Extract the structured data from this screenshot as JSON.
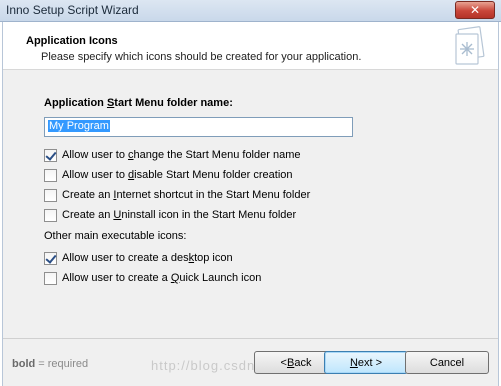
{
  "window": {
    "title": "Inno Setup Script Wizard",
    "close_glyph": "✕"
  },
  "header": {
    "title": "Application Icons",
    "subtitle": "Please specify which icons should be created for your application."
  },
  "start_menu": {
    "label_pre": "Application ",
    "label_u": "S",
    "label_post": "tart Menu folder name:",
    "value": "My Program"
  },
  "checkboxes": [
    {
      "pre": "Allow user to ",
      "u": "c",
      "post": "hange the Start Menu folder name",
      "checked": true
    },
    {
      "pre": "Allow user to ",
      "u": "d",
      "post": "isable Start Menu folder creation",
      "checked": false
    },
    {
      "pre": "Create an ",
      "u": "I",
      "post": "nternet shortcut in the Start Menu folder",
      "checked": false
    },
    {
      "pre": "Create an ",
      "u": "U",
      "post": "ninstall icon in the Start Menu folder",
      "checked": false
    }
  ],
  "other_icons": {
    "label": "Other main executable icons:",
    "items": [
      {
        "pre": "Allow user to create a des",
        "u": "k",
        "post": "top icon",
        "checked": true
      },
      {
        "pre": "Allow user to create a ",
        "u": "Q",
        "post": "uick Launch icon",
        "checked": false
      }
    ]
  },
  "footer": {
    "note_bold": "bold",
    "note_rest": " = required",
    "watermark": "http://blog.csdn.net/"
  },
  "buttons": {
    "back_pre": "< ",
    "back_u": "B",
    "back_post": "ack",
    "next_u": "N",
    "next_post": "ext >",
    "cancel": "Cancel"
  }
}
